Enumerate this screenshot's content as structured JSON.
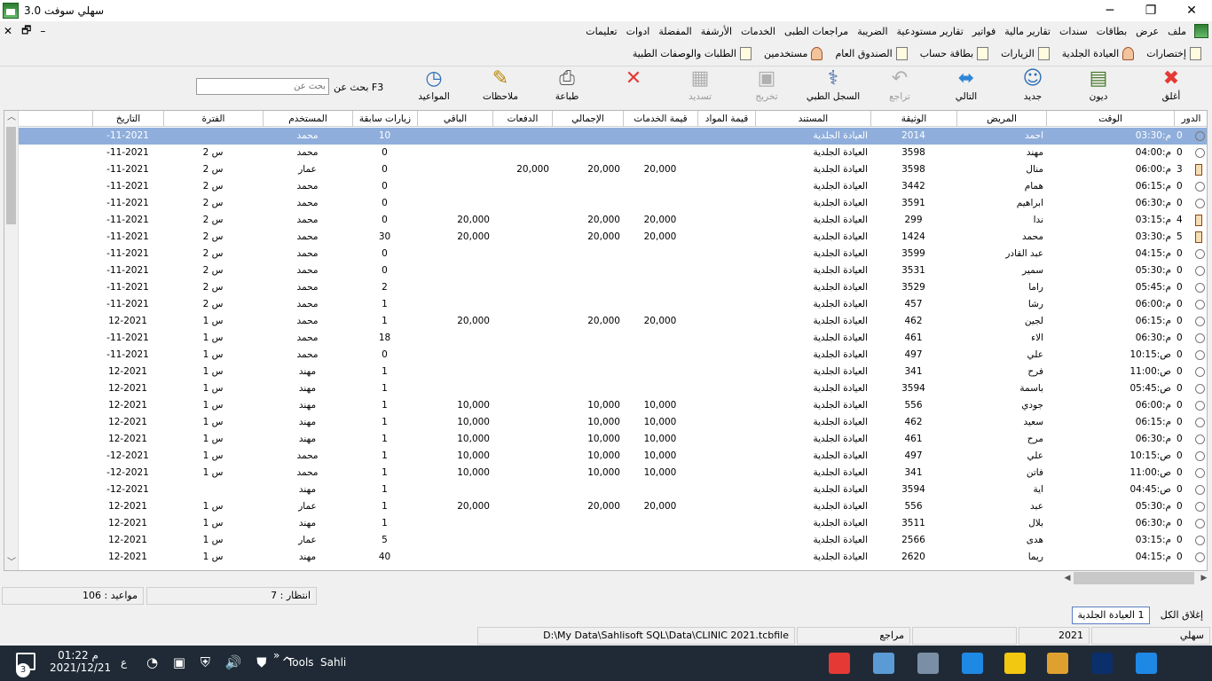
{
  "window": {
    "title": "سهلي سوفت 3.0",
    "minimize": "─",
    "restore": "❐",
    "close": "✕"
  },
  "mdi_controls": {
    "close": "✕",
    "restore": "🗗",
    "minimize": "–"
  },
  "menu": [
    "ملف",
    "عرض",
    "بطاقات",
    "سندات",
    "تقارير مالية",
    "فواتير",
    "تقارير مستودعية",
    "الضريبة",
    "مراجعات الطبى",
    "الخدمات",
    "الأرشفة",
    "المفضلة",
    "ادوات",
    "تعليمات"
  ],
  "shortcuts": [
    {
      "label": "إختصارات",
      "icon": "doc-icon"
    },
    {
      "label": "العيادة الجلدية",
      "icon": "person-icon"
    },
    {
      "label": "الزيارات",
      "icon": "doc-icon"
    },
    {
      "label": "بطاقة حساب",
      "icon": "doc-icon"
    },
    {
      "label": "الصندوق العام",
      "icon": "doc-icon"
    },
    {
      "label": "مستخدمين",
      "icon": "person-icon"
    },
    {
      "label": "الطلبات والوصفات الطبية",
      "icon": "doc-icon"
    }
  ],
  "toolbar": {
    "close": {
      "label": "أغلق",
      "icon": "✖",
      "color": "#e53935"
    },
    "debts": {
      "label": "ديون",
      "icon": "▤",
      "color": "#4a7a2c"
    },
    "new": {
      "label": "جديد",
      "icon": "☺",
      "color": "#2f6fb5"
    },
    "next": {
      "label": "التالي",
      "icon": "⬌",
      "color": "#2f86d6"
    },
    "undo": {
      "label": "تراجع",
      "icon": "↶",
      "color": "#9a9a9a"
    },
    "medical_record": {
      "label": "السجل الطبي",
      "icon": "⚕",
      "color": "#3a5fa0"
    },
    "checkout": {
      "label": "تخريج",
      "icon": "▣",
      "color": "#aaaaaa"
    },
    "pay": {
      "label": "تسديد",
      "icon": "▦",
      "color": "#aaaaaa"
    },
    "cancel": {
      "label": "",
      "icon": "✕",
      "color": "#e53935"
    },
    "print": {
      "label": "طباعة",
      "icon": "⎙",
      "color": "#555555"
    },
    "notes": {
      "label": "ملاحظات",
      "icon": "✎",
      "color": "#b8860b"
    },
    "appointments": {
      "label": "المواعيد",
      "icon": "◷",
      "color": "#2f6fb5"
    }
  },
  "search": {
    "label": "F3 بحث عن",
    "placeholder": "بحث عن"
  },
  "columns": [
    "الدور",
    "الوقت",
    "المريض",
    "الوثيقة",
    "المستند",
    "قيمة المواد",
    "قيمة الخدمات",
    "الإجمالي",
    "الدفعات",
    "الباقي",
    "زيارات سابقة",
    "المستخدم",
    "الفترة",
    "التاريخ"
  ],
  "rows": [
    {
      "turn": "0",
      "time": "03:30:م",
      "patient": "احمد",
      "doc": "2014",
      "document": "العيادة الجلدية",
      "materials": "",
      "services": "",
      "total": "",
      "payments": "",
      "remaining": "",
      "visits": "10",
      "user": "محمد",
      "period": "",
      "date": "-11-2021",
      "icon": "circle"
    },
    {
      "turn": "0",
      "time": "04:00:م",
      "patient": "مهند",
      "doc": "3598",
      "document": "العيادة الجلدية",
      "materials": "",
      "services": "",
      "total": "",
      "payments": "",
      "remaining": "",
      "visits": "0",
      "user": "محمد",
      "period": "2 س",
      "date": "-11-2021",
      "icon": "circle"
    },
    {
      "turn": "3",
      "time": "06:00:م",
      "patient": "منال",
      "doc": "3598",
      "document": "العيادة الجلدية",
      "materials": "",
      "services": "20,000",
      "total": "20,000",
      "payments": "20,000",
      "remaining": "",
      "visits": "0",
      "user": "عمار",
      "period": "2 س",
      "date": "-11-2021",
      "icon": "hour"
    },
    {
      "turn": "0",
      "time": "06:15:م",
      "patient": "همام",
      "doc": "3442",
      "document": "العيادة الجلدية",
      "materials": "",
      "services": "",
      "total": "",
      "payments": "",
      "remaining": "",
      "visits": "0",
      "user": "محمد",
      "period": "2 س",
      "date": "-11-2021",
      "icon": "circle"
    },
    {
      "turn": "0",
      "time": "06:30:م",
      "patient": "ابراهيم",
      "doc": "3591",
      "document": "العيادة الجلدية",
      "materials": "",
      "services": "",
      "total": "",
      "payments": "",
      "remaining": "",
      "visits": "0",
      "user": "محمد",
      "period": "2 س",
      "date": "-11-2021",
      "icon": "circle"
    },
    {
      "turn": "4",
      "time": "03:15:م",
      "patient": "ندا",
      "doc": "299",
      "document": "العيادة الجلدية",
      "materials": "",
      "services": "20,000",
      "total": "20,000",
      "payments": "",
      "remaining": "20,000",
      "visits": "0",
      "user": "محمد",
      "period": "2 س",
      "date": "-11-2021",
      "icon": "hour"
    },
    {
      "turn": "5",
      "time": "03:30:م",
      "patient": "محمد",
      "doc": "1424",
      "document": "العيادة الجلدية",
      "materials": "",
      "services": "20,000",
      "total": "20,000",
      "payments": "",
      "remaining": "20,000",
      "visits": "30",
      "user": "محمد",
      "period": "2 س",
      "date": "-11-2021",
      "icon": "hour"
    },
    {
      "turn": "0",
      "time": "04:15:م",
      "patient": "عبد القادر",
      "doc": "3599",
      "document": "العيادة الجلدية",
      "materials": "",
      "services": "",
      "total": "",
      "payments": "",
      "remaining": "",
      "visits": "0",
      "user": "محمد",
      "period": "2 س",
      "date": "-11-2021",
      "icon": "circle"
    },
    {
      "turn": "0",
      "time": "05:30:م",
      "patient": "سمير",
      "doc": "3531",
      "document": "العيادة الجلدية",
      "materials": "",
      "services": "",
      "total": "",
      "payments": "",
      "remaining": "",
      "visits": "0",
      "user": "محمد",
      "period": "2 س",
      "date": "-11-2021",
      "icon": "circle"
    },
    {
      "turn": "0",
      "time": "05:45:م",
      "patient": "راما",
      "doc": "3529",
      "document": "العيادة الجلدية",
      "materials": "",
      "services": "",
      "total": "",
      "payments": "",
      "remaining": "",
      "visits": "2",
      "user": "محمد",
      "period": "2 س",
      "date": "-11-2021",
      "icon": "circle"
    },
    {
      "turn": "0",
      "time": "06:00:م",
      "patient": "رشا",
      "doc": "457",
      "document": "العيادة الجلدية",
      "materials": "",
      "services": "",
      "total": "",
      "payments": "",
      "remaining": "",
      "visits": "1",
      "user": "محمد",
      "period": "2 س",
      "date": "-11-2021",
      "icon": "circle"
    },
    {
      "turn": "0",
      "time": "06:15:م",
      "patient": "لجين",
      "doc": "462",
      "document": "العيادة الجلدية",
      "materials": "",
      "services": "20,000",
      "total": "20,000",
      "payments": "",
      "remaining": "20,000",
      "visits": "1",
      "user": "محمد",
      "period": "1 س",
      "date": "12-2021",
      "icon": "circle"
    },
    {
      "turn": "0",
      "time": "06:30:م",
      "patient": "الاء",
      "doc": "461",
      "document": "العيادة الجلدية",
      "materials": "",
      "services": "",
      "total": "",
      "payments": "",
      "remaining": "",
      "visits": "18",
      "user": "محمد",
      "period": "1 س",
      "date": "-11-2021",
      "icon": "circle"
    },
    {
      "turn": "0",
      "time": "10:15:ص",
      "patient": "علي",
      "doc": "497",
      "document": "العيادة الجلدية",
      "materials": "",
      "services": "",
      "total": "",
      "payments": "",
      "remaining": "",
      "visits": "0",
      "user": "محمد",
      "period": "1 س",
      "date": "-11-2021",
      "icon": "circle"
    },
    {
      "turn": "0",
      "time": "11:00:ص",
      "patient": "فرح",
      "doc": "341",
      "document": "العيادة الجلدية",
      "materials": "",
      "services": "",
      "total": "",
      "payments": "",
      "remaining": "",
      "visits": "1",
      "user": "مهند",
      "period": "1 س",
      "date": "12-2021",
      "icon": "circle"
    },
    {
      "turn": "0",
      "time": "05:45:ص",
      "patient": "باسمة",
      "doc": "3594",
      "document": "العيادة الجلدية",
      "materials": "",
      "services": "",
      "total": "",
      "payments": "",
      "remaining": "",
      "visits": "1",
      "user": "مهند",
      "period": "1 س",
      "date": "12-2021",
      "icon": "circle"
    },
    {
      "turn": "0",
      "time": "06:00:م",
      "patient": "جودي",
      "doc": "556",
      "document": "العيادة الجلدية",
      "materials": "",
      "services": "10,000",
      "total": "10,000",
      "payments": "",
      "remaining": "10,000",
      "visits": "1",
      "user": "مهند",
      "period": "1 س",
      "date": "12-2021",
      "icon": "circle"
    },
    {
      "turn": "0",
      "time": "06:15:م",
      "patient": "سعيد",
      "doc": "462",
      "document": "العيادة الجلدية",
      "materials": "",
      "services": "10,000",
      "total": "10,000",
      "payments": "",
      "remaining": "10,000",
      "visits": "1",
      "user": "مهند",
      "period": "1 س",
      "date": "12-2021",
      "icon": "circle"
    },
    {
      "turn": "0",
      "time": "06:30:م",
      "patient": "مرح",
      "doc": "461",
      "document": "العيادة الجلدية",
      "materials": "",
      "services": "10,000",
      "total": "10,000",
      "payments": "",
      "remaining": "10,000",
      "visits": "1",
      "user": "مهند",
      "period": "1 س",
      "date": "12-2021",
      "icon": "circle"
    },
    {
      "turn": "0",
      "time": "10:15:ص",
      "patient": "علي",
      "doc": "497",
      "document": "العيادة الجلدية",
      "materials": "",
      "services": "10,000",
      "total": "10,000",
      "payments": "",
      "remaining": "10,000",
      "visits": "1",
      "user": "محمد",
      "period": "1 س",
      "date": "-12-2021",
      "icon": "circle"
    },
    {
      "turn": "0",
      "time": "11:00:ص",
      "patient": "فاتن",
      "doc": "341",
      "document": "العيادة الجلدية",
      "materials": "",
      "services": "10,000",
      "total": "10,000",
      "payments": "",
      "remaining": "10,000",
      "visits": "1",
      "user": "محمد",
      "period": "1 س",
      "date": "-12-2021",
      "icon": "circle"
    },
    {
      "turn": "0",
      "time": "04:45:ص",
      "patient": "اية",
      "doc": "3594",
      "document": "العيادة الجلدية",
      "materials": "",
      "services": "",
      "total": "",
      "payments": "",
      "remaining": "",
      "visits": "1",
      "user": "مهند",
      "period": "",
      "date": "-12-2021",
      "icon": "circle"
    },
    {
      "turn": "0",
      "time": "05:30:م",
      "patient": "عبد",
      "doc": "556",
      "document": "العيادة الجلدية",
      "materials": "",
      "services": "20,000",
      "total": "20,000",
      "payments": "",
      "remaining": "20,000",
      "visits": "1",
      "user": "عمار",
      "period": "1 س",
      "date": "12-2021",
      "icon": "circle"
    },
    {
      "turn": "0",
      "time": "06:30:م",
      "patient": "بلال",
      "doc": "3511",
      "document": "العيادة الجلدية",
      "materials": "",
      "services": "",
      "total": "",
      "payments": "",
      "remaining": "",
      "visits": "1",
      "user": "مهند",
      "period": "1 س",
      "date": "12-2021",
      "icon": "circle"
    },
    {
      "turn": "0",
      "time": "03:15:م",
      "patient": "هدى",
      "doc": "2566",
      "document": "العيادة الجلدية",
      "materials": "",
      "services": "",
      "total": "",
      "payments": "",
      "remaining": "",
      "visits": "5",
      "user": "عمار",
      "period": "1 س",
      "date": "12-2021",
      "icon": "circle"
    },
    {
      "turn": "0",
      "time": "04:15:م",
      "patient": "ريما",
      "doc": "2620",
      "document": "العيادة الجلدية",
      "materials": "",
      "services": "",
      "total": "",
      "payments": "",
      "remaining": "",
      "visits": "40",
      "user": "مهند",
      "period": "1 س",
      "date": "12-2021",
      "icon": "circle"
    }
  ],
  "status": {
    "appointments": "مواعيد : 106",
    "waiting": "انتظار : 7"
  },
  "tabs": {
    "close_all": "إغلاق الكل",
    "active_tab": "1 العيادة الجلدية"
  },
  "statusbar": {
    "user": "سهلي",
    "year": "2021",
    "role": "مراجع",
    "file": "D:\\My Data\\Sahlisoft SQL\\Data\\CLINIC 2021.tcbfile"
  },
  "taskbar": {
    "notifications": "3",
    "time": "01:22 م",
    "date": "2021/12/21",
    "lang": "ع",
    "tray": "◔ ▣ ⛨ 🔊 ⛊ ^",
    "tools": "Tools",
    "sahli": "Sahli",
    "chevrons": "»"
  },
  "taskbar_apps": [
    {
      "name": "anydesk-icon",
      "color": "#e53935"
    },
    {
      "name": "calculator-icon",
      "color": "#5b9bd5"
    },
    {
      "name": "remote-icon",
      "color": "#7a8fa6"
    },
    {
      "name": "ccleaner-icon",
      "color": "#1e88e5"
    },
    {
      "name": "powerbi-icon",
      "color": "#f2c811"
    },
    {
      "name": "paint-icon",
      "color": "#e0a030"
    },
    {
      "name": "photoshop-icon",
      "color": "#0a2f6a"
    },
    {
      "name": "ie-icon",
      "color": "#1e88e5"
    }
  ]
}
